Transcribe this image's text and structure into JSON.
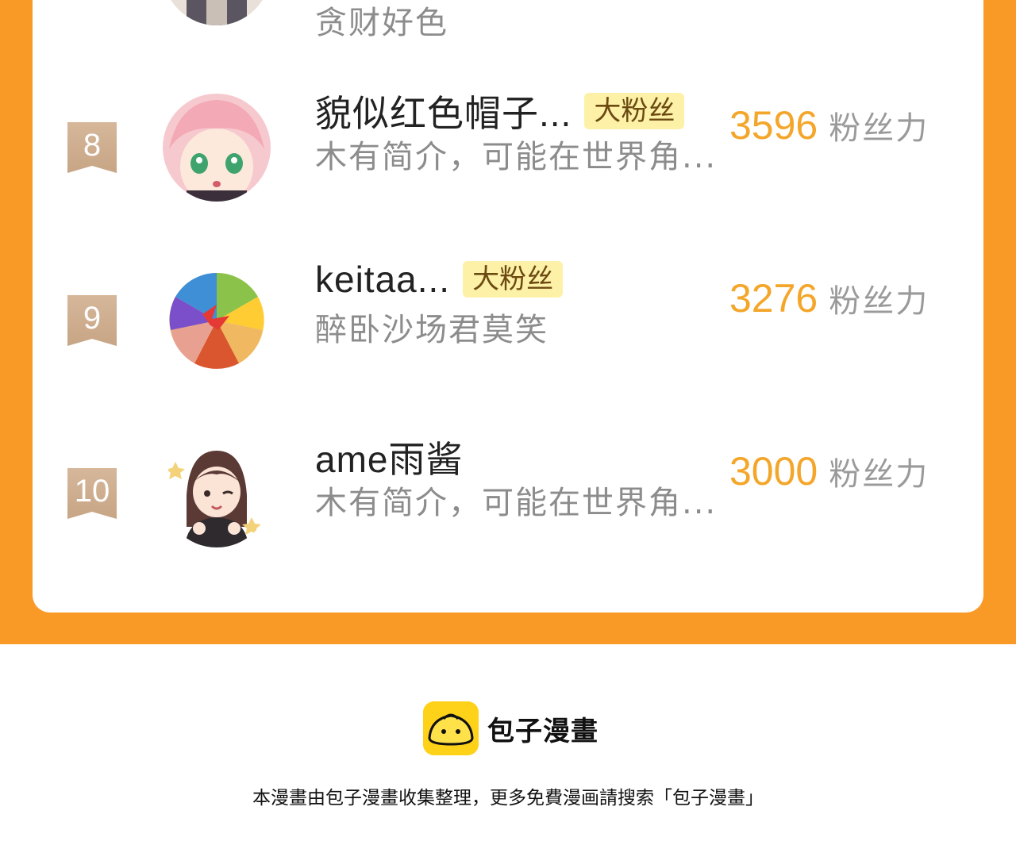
{
  "prev_row": {
    "intro": "贪财好色"
  },
  "rows": [
    {
      "rank": "8",
      "name": "貌似红色帽子...",
      "badge": "大粉丝",
      "intro": "木有简介，可能在世界角...",
      "fans_value": "3596",
      "fans_unit": "粉丝力"
    },
    {
      "rank": "9",
      "name": "keitaa...",
      "badge": "大粉丝",
      "intro": "醉卧沙场君莫笑",
      "fans_value": "3276",
      "fans_unit": "粉丝力"
    },
    {
      "rank": "10",
      "name": "ame雨酱",
      "intro": "木有简介，可能在世界角...",
      "fans_value": "3000",
      "fans_unit": "粉丝力"
    }
  ],
  "footer": {
    "brand": "包子漫畫",
    "note": "本漫畫由包子漫畫收集整理，更多免費漫画請搜索「包子漫畫」"
  },
  "colors": {
    "accent_orange": "#fa9a26",
    "fans_number": "#f4a62a",
    "badge_bg": "#fdf1a8",
    "rank_flag": "#c7a585",
    "logo_yellow": "#ffd21a"
  },
  "icons": [
    "rank-flag-icon",
    "baozi-logo-icon"
  ]
}
